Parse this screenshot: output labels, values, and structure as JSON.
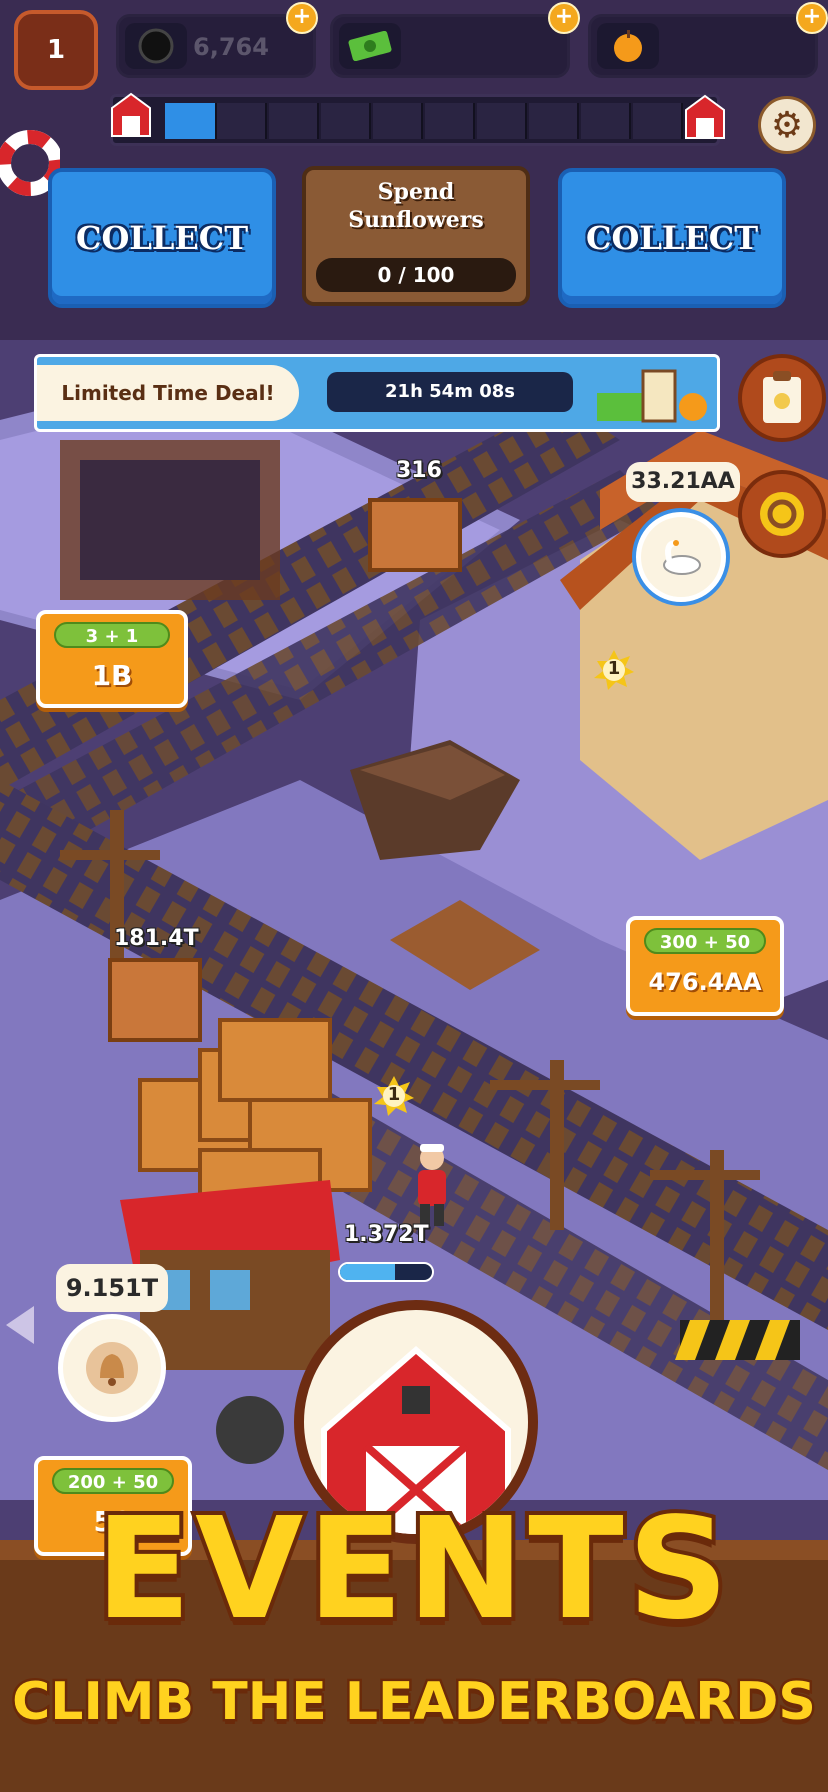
{
  "hud": {
    "level": "1",
    "resources": [
      {
        "icon": "coin-icon",
        "value": "6,764"
      },
      {
        "icon": "cash-icon",
        "value": ""
      },
      {
        "icon": "apple-icon",
        "value": ""
      }
    ],
    "plus_label": "+",
    "progress_fraction": 0.1
  },
  "collect_left": "COLLECT",
  "collect_right": "COLLECT",
  "spend": {
    "title": "Spend Sunflowers",
    "progress": "0 / 100"
  },
  "deal": {
    "label": "Limited Time Deal!",
    "timer": "21h 54m 08s"
  },
  "world": {
    "crate_top": "316",
    "swan_value": "33.21AA",
    "left_upgrade": {
      "level": "3 + 1",
      "cost": "1B"
    },
    "right_upgrade": {
      "level": "300 + 50",
      "cost": "476.4AA"
    },
    "crate_mid": "181.4T",
    "worker_value": "1.372T",
    "bell_value": "9.151T",
    "bottom_upgrade": {
      "level": "200 + 50",
      "cost": "59"
    },
    "sun_badges": [
      "1",
      "1"
    ],
    "worker_progress_fraction": 0.6
  },
  "promo": {
    "title": "EVENTS",
    "subtitle": "CLIMB THE LEADERBOARDS"
  },
  "colors": {
    "accent_blue": "#2f8fe6",
    "orange": "#f59a1a",
    "green": "#7ec13b",
    "title_yellow": "#ffd21f"
  }
}
